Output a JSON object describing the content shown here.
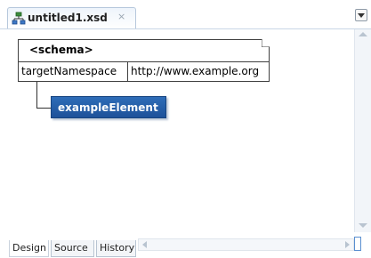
{
  "editor_tab": {
    "title": "untitled1.xsd",
    "close_glyph": "×",
    "icon": "xsd-file-icon"
  },
  "diagram": {
    "schema": {
      "title": "<schema>",
      "attribute_name": "targetNamespace",
      "attribute_value": "http://www.example.org"
    },
    "element": {
      "name": "exampleElement",
      "color": "#245ea8"
    }
  },
  "bottom_tabs": [
    {
      "label": "Design",
      "active": true
    },
    {
      "label": "Source",
      "active": false
    },
    {
      "label": "History",
      "active": false
    }
  ]
}
